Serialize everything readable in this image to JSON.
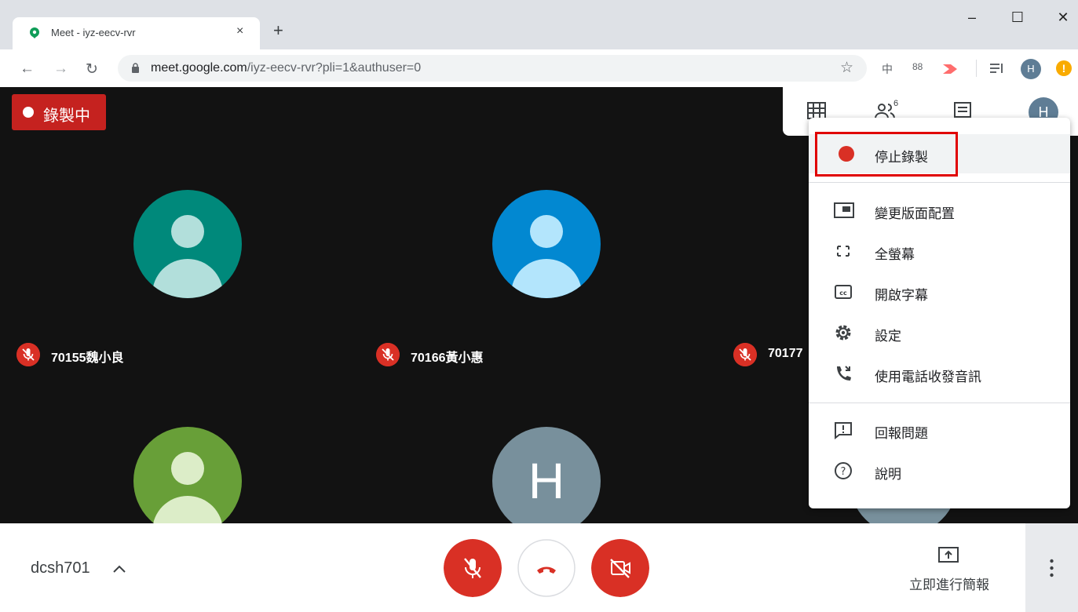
{
  "browser": {
    "tab_title": "Meet - iyz-eecv-rvr",
    "tab_close": "×",
    "new_tab": "+",
    "url_host": "meet.google.com",
    "url_path": "/iyz-eecv-rvr?pli=1&authuser=0",
    "profile_initial": "H",
    "warning_glyph": "!",
    "ext_labels": [
      "中",
      "88"
    ],
    "window_controls": [
      "–",
      "☐",
      "✕"
    ]
  },
  "meet": {
    "recording_label": "錄製中",
    "people_count": "6",
    "self_initial": "H",
    "participants": [
      {
        "name": "70155魏小良",
        "avatar_color": "#00897b",
        "fg": "#b2dfdb"
      },
      {
        "name": "70166黃小惠",
        "avatar_color": "#0288d1",
        "fg": "#b3e5fc"
      },
      {
        "name": "70177",
        "avatar_color": "#5f7d95",
        "fg": "#b0bec5"
      }
    ],
    "lower_row": [
      {
        "avatar_color": "#689f38",
        "fg": "#dcedc8"
      },
      {
        "avatar_color": "#78909c",
        "initial": "H"
      }
    ]
  },
  "menu": {
    "items": [
      {
        "label": "停止錄製",
        "icon": "record-dot-icon"
      },
      {
        "label": "變更版面配置",
        "icon": "layout-icon"
      },
      {
        "label": "全螢幕",
        "icon": "fullscreen-icon"
      },
      {
        "label": "開啟字幕",
        "icon": "captions-icon"
      },
      {
        "label": "設定",
        "icon": "gear-icon"
      },
      {
        "label": "使用電話收發音訊",
        "icon": "phone-icon"
      },
      {
        "label": "回報問題",
        "icon": "feedback-icon"
      },
      {
        "label": "說明",
        "icon": "help-icon"
      }
    ]
  },
  "bottom": {
    "meeting_code": "dcsh701",
    "chevron": "^",
    "present_label": "立即進行簡報"
  },
  "colors": {
    "recording_red": "#c5221f",
    "danger_red": "#d93025",
    "stage_bg": "#121212"
  }
}
